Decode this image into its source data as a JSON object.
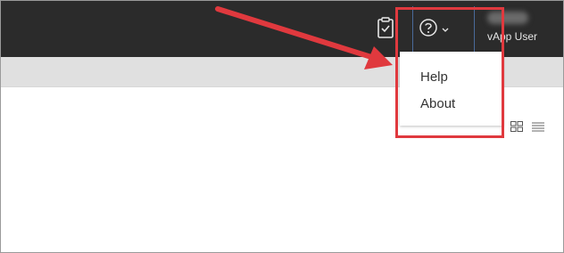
{
  "header": {
    "user_name": "vApp User"
  },
  "help_menu": {
    "items": [
      {
        "label": "Help"
      },
      {
        "label": "About"
      }
    ]
  },
  "icons": {
    "tasks": "clipboard-check-icon",
    "help": "question-circle-icon",
    "caret": "chevron-down-icon",
    "grid_view": "grid-view-icon",
    "list_view": "list-view-icon"
  },
  "colors": {
    "topbar": "#2b2b2b",
    "subbar": "#e0e0e0",
    "annotation": "#e0393e"
  }
}
